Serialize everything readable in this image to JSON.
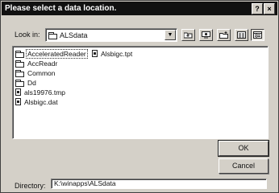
{
  "window": {
    "title": "Please select a data location.",
    "help_glyph": "?",
    "close_glyph": "×"
  },
  "lookin": {
    "label": "Look in:",
    "value": "ALSdata"
  },
  "toolbar": {
    "icons": [
      "up-one-level-icon",
      "desktop-icon",
      "create-new-folder-icon",
      "list-view-icon",
      "details-view-icon"
    ]
  },
  "files": {
    "column1": [
      {
        "name": "AcceleratedReader",
        "type": "folder"
      },
      {
        "name": "AccReadr",
        "type": "folder"
      },
      {
        "name": "Common",
        "type": "folder"
      },
      {
        "name": "Dd",
        "type": "folder"
      },
      {
        "name": "als19976.tmp",
        "type": "file"
      },
      {
        "name": "Alsbigc.dat",
        "type": "file"
      }
    ],
    "column2": [
      {
        "name": "Alsbigc.tpt",
        "type": "file"
      }
    ]
  },
  "buttons": {
    "ok": "OK",
    "cancel": "Cancel"
  },
  "directory": {
    "label": "Directory:",
    "value": "K:\\winapps\\ALSdata"
  }
}
